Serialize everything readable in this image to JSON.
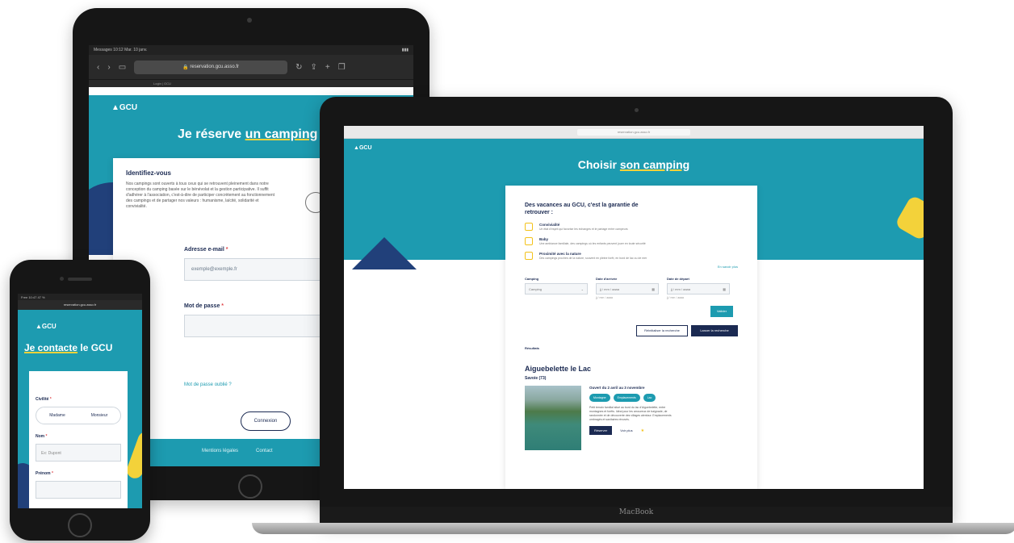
{
  "tablet": {
    "status_bar": "Messages  10:12  Mar. 10 janv.",
    "url": "reservation.gcu.asso.fr",
    "tab_label": "Login | GCU",
    "logo": "GCU",
    "title_prefix": "Je réserve ",
    "title_highlight": "un camping",
    "card_heading": "Identifiez-vous",
    "card_text": "Nos campings sont ouverts à tous ceux qui se retrouvent pleinement dans notre conception du camping basée sur le bénévolat et la gestion participative. Il suffit d'adhérer à l'association, c'est-à-dire de participer concrètement au fonctionnement des campings et de partager nos valeurs : humanisme, laïcité, solidarité et convivialité.",
    "email_label": "Adresse e-mail",
    "email_placeholder": "exemple@exemple.fr",
    "password_label": "Mot de passe",
    "forgot_link": "Mot de passe oublié ?",
    "login_button": "Connexion",
    "footer_links": [
      "Mentions légales",
      "Contact"
    ]
  },
  "laptop": {
    "url": "reservation.gcu.asso.fr",
    "logo": "GCU",
    "title_prefix": "Choisir ",
    "title_highlight": "son camping",
    "card_heading": "Des vacances au GCU, c'est la garantie de retrouver :",
    "features": [
      {
        "title": "Convivialité",
        "desc": "Un état d'esprit qui favorise les échanges et le partage entre campeurs"
      },
      {
        "title": "Baby",
        "desc": "Une ambiance familiale, des campings où les enfants peuvent jouer en toute sécurité"
      },
      {
        "title": "Proximité avec la nature",
        "desc": "Des campings proches de la nature, souvent en pleine forêt, en bord de lac ou de mer"
      }
    ],
    "more_link": "En savoir plus",
    "filters": [
      {
        "label": "Camping",
        "value": "Camping",
        "sub": ""
      },
      {
        "label": "Date d'arrivée",
        "value": "jj / mm / aaaa",
        "sub": "jj / mm / aaaa"
      },
      {
        "label": "Date de départ",
        "value": "jj / mm / aaaa",
        "sub": "jj / mm / aaaa"
      }
    ],
    "validate_button": "Valider",
    "reset_button": "Réinitialiser la recherche",
    "search_button": "Lancer la recherche",
    "results_label": "Résultats",
    "camping_name": "Aiguebelette le Lac",
    "camping_region": "Savoie (73)",
    "camping_dates": "Ouvert du 2 avril au 3 novembre",
    "tags": [
      "Montagne",
      "Emplacements",
      "Lac"
    ],
    "camping_desc": "Petit terrain familial situé au bord du lac d'Aiguebelette, entre montagnes et forêts. Idéal pour les amoureux de baignade, de randonnée et de découverte des villages alentour. Emplacements ombragés et sanitaires rénovés.",
    "book_button": "Réserver",
    "details_link": "Voir plus",
    "brand": "MacBook"
  },
  "phone": {
    "status_bar": "Free  10:47  47 %",
    "url": "reservation.gcu.asso.fr",
    "logo": "GCU",
    "title_highlight": "Je contacte",
    "title_suffix": " le GCU",
    "civility_label": "Civilité",
    "civility_options": [
      "Madame",
      "Monsieur"
    ],
    "name_label": "Nom",
    "name_placeholder": "Ex: Dupont",
    "firstname_label": "Prénom"
  },
  "colors": {
    "teal": "#1d9bb0",
    "navy": "#1b2a52",
    "yellow": "#f3d23a",
    "required": "#e0464a"
  }
}
